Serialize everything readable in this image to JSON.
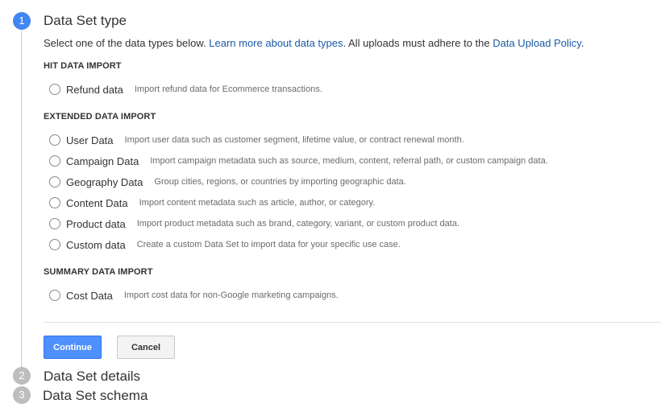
{
  "steps": [
    {
      "number": "1",
      "title": "Data Set type"
    },
    {
      "number": "2",
      "title": "Data Set details"
    },
    {
      "number": "3",
      "title": "Data Set schema"
    }
  ],
  "intro": {
    "text_before": "Select one of the data types below. ",
    "link_learn": "Learn more about data types",
    "text_middle": ". All uploads must adhere to the ",
    "link_policy": "Data Upload Policy",
    "text_after": "."
  },
  "sections": {
    "hit": {
      "heading": "HIT DATA IMPORT",
      "options": [
        {
          "label": "Refund data",
          "desc": "Import refund data for Ecommerce transactions."
        }
      ]
    },
    "extended": {
      "heading": "EXTENDED DATA IMPORT",
      "options": [
        {
          "label": "User Data",
          "desc": "Import user data such as customer segment, lifetime value, or contract renewal month."
        },
        {
          "label": "Campaign Data",
          "desc": "Import campaign metadata such as source, medium, content, referral path, or custom campaign data."
        },
        {
          "label": "Geography Data",
          "desc": "Group cities, regions, or countries by importing geographic data."
        },
        {
          "label": "Content Data",
          "desc": "Import content metadata such as article, author, or category."
        },
        {
          "label": "Product data",
          "desc": "Import product metadata such as brand, category, variant, or custom product data."
        },
        {
          "label": "Custom data",
          "desc": "Create a custom Data Set to import data for your specific use case."
        }
      ]
    },
    "summary": {
      "heading": "SUMMARY DATA IMPORT",
      "options": [
        {
          "label": "Cost Data",
          "desc": "Import cost data for non-Google marketing campaigns."
        }
      ]
    }
  },
  "buttons": {
    "continue": "Continue",
    "cancel": "Cancel"
  },
  "colors": {
    "step_active": "#4285f4",
    "step_inactive": "#bdbdbd",
    "link": "#1a5aa8",
    "primary_button": "#4d90fe"
  }
}
